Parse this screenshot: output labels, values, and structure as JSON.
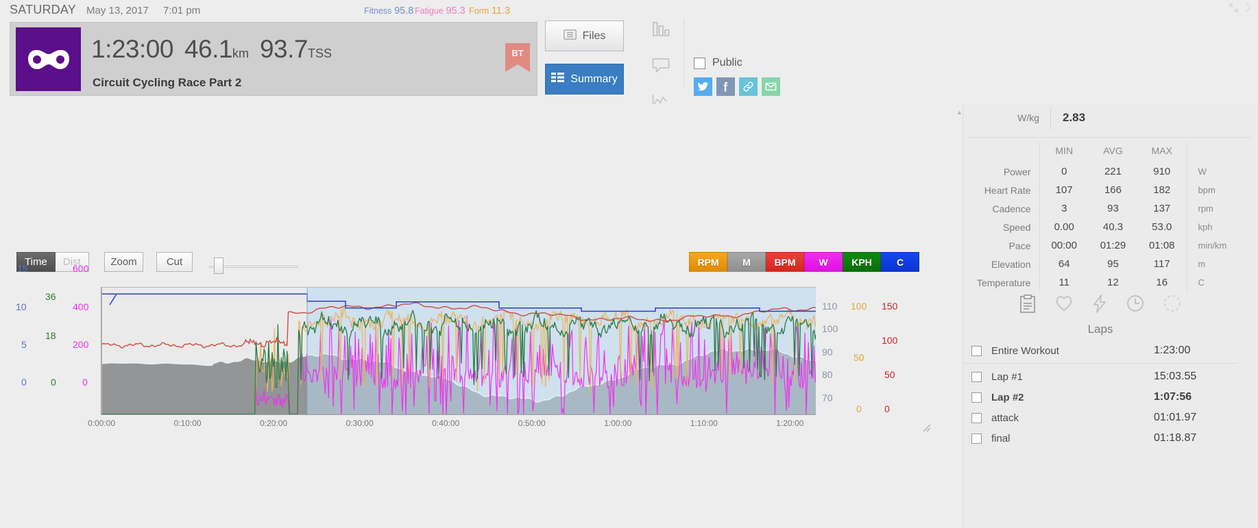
{
  "header": {
    "day": "SATURDAY",
    "date": "May 13, 2017",
    "time": "7:01 pm",
    "pmc": {
      "fitness_label": "Fitness",
      "fitness_value": "95.8",
      "fitness_color": "#6f92c9",
      "fatigue_label": "Fatigue",
      "fatigue_value": "95.3",
      "fatigue_color": "#ef7ec0",
      "form_label": "Form",
      "form_value": "11.3",
      "form_color": "#e8a33d"
    },
    "duration": "1:23:00",
    "distance": "46.1",
    "distance_unit": "km",
    "tss": "93.7",
    "tss_unit": "TSS",
    "workout_title": "Circuit Cycling Race Part 2",
    "badge": "BT",
    "files_button": "Files",
    "summary_button": "Summary",
    "public_label": "Public",
    "public_checked": false,
    "side_icons": [
      "bar-chart-icon",
      "comment-icon",
      "trend-icon"
    ],
    "social_icons": [
      {
        "name": "twitter-icon",
        "color": "#55acee"
      },
      {
        "name": "facebook-icon",
        "color": "#7f97b5"
      },
      {
        "name": "link-icon",
        "color": "#68c2d8"
      },
      {
        "name": "email-icon",
        "color": "#86d6aa"
      }
    ],
    "window_icons": [
      "expand-icon",
      "chevron-right-icon"
    ]
  },
  "chart_controls": {
    "time_label": "Time",
    "dist_label": "Dist",
    "zoom_label": "Zoom",
    "cut_label": "Cut",
    "active": "Time",
    "slider_value": 5
  },
  "legend": [
    {
      "label": "RPM",
      "color": "#f5a623",
      "gradient_to": "#e08c00"
    },
    {
      "label": "M",
      "color": "#a8a8a8",
      "gradient_to": "#8f8f8f"
    },
    {
      "label": "BPM",
      "color": "#e8433c",
      "gradient_to": "#d6241c"
    },
    {
      "label": "W",
      "color": "#ee2fee",
      "gradient_to": "#e010e0"
    },
    {
      "label": "KPH",
      "color": "#0f8a0f",
      "gradient_to": "#0a6f0a"
    },
    {
      "label": "C",
      "color": "#1548ee",
      "gradient_to": "#0b33d6"
    }
  ],
  "chart_data": {
    "type": "line",
    "title": "",
    "xlabel": "",
    "ylabel": "",
    "grid": false,
    "legend_position": "top-right",
    "x_ticks": [
      "0:00:00",
      "0:10:00",
      "0:20:00",
      "0:30:00",
      "0:40:00",
      "0:50:00",
      "1:00:00",
      "1:10:00",
      "1:20:00"
    ],
    "x_range_minutes": [
      0,
      83
    ],
    "selection_start_time": "0:14:30",
    "selection_end_time": "1:23:00",
    "axes": [
      {
        "id": "C",
        "side": "left",
        "label": "C",
        "color": "#5b6fd6",
        "ticks": [
          0,
          5,
          10,
          15
        ],
        "range": [
          0,
          17
        ]
      },
      {
        "id": "KPH",
        "side": "left",
        "label": "KPH",
        "color": "#2d7d2d",
        "ticks": [
          0,
          18,
          36
        ],
        "range": [
          0,
          53
        ]
      },
      {
        "id": "W",
        "side": "left",
        "label": "W",
        "color": "#ee2fee",
        "ticks": [
          0,
          200,
          400,
          600
        ],
        "range": [
          0,
          910
        ]
      },
      {
        "id": "M",
        "side": "right",
        "label": "M",
        "color": "#8795a6",
        "ticks": [
          70,
          80,
          90,
          100,
          110
        ],
        "range": [
          64,
          117
        ]
      },
      {
        "id": "RPM",
        "side": "right",
        "label": "RPM",
        "color": "#e8a33d",
        "ticks": [
          0,
          50,
          100
        ],
        "range": [
          0,
          137
        ]
      },
      {
        "id": "BPM",
        "side": "right",
        "label": "BPM",
        "color": "#cf2222",
        "ticks": [
          0,
          50,
          100,
          150
        ],
        "range": [
          0,
          182
        ]
      }
    ],
    "series": [
      {
        "name": "Elevation",
        "axis": "M",
        "color": "#98a7b5",
        "style": "area"
      },
      {
        "name": "Heart Rate",
        "axis": "BPM",
        "color": "#cf4a42",
        "style": "line"
      },
      {
        "name": "Cadence",
        "axis": "RPM",
        "color": "#e8b45c",
        "style": "line"
      },
      {
        "name": "Speed",
        "axis": "KPH",
        "color": "#2d7d4a",
        "style": "line"
      },
      {
        "name": "Power",
        "axis": "W",
        "color": "#ee2fee",
        "style": "line"
      },
      {
        "name": "Temperature",
        "axis": "C",
        "color": "#2a3fc9",
        "style": "step"
      }
    ]
  },
  "right_panel": {
    "wkg_label": "W/kg",
    "wkg_value": "2.83",
    "columns": [
      "MIN",
      "AVG",
      "MAX"
    ],
    "rows": [
      {
        "label": "Power",
        "min": "0",
        "avg": "221",
        "max": "910",
        "unit": "W"
      },
      {
        "label": "Heart Rate",
        "min": "107",
        "avg": "166",
        "max": "182",
        "unit": "bpm"
      },
      {
        "label": "Cadence",
        "min": "3",
        "avg": "93",
        "max": "137",
        "unit": "rpm"
      },
      {
        "label": "Speed",
        "min": "0.00",
        "avg": "40.3",
        "max": "53.0",
        "unit": "kph"
      },
      {
        "label": "Pace",
        "min": "00:00",
        "avg": "01:29",
        "max": "01:08",
        "unit": "min/km"
      },
      {
        "label": "Elevation",
        "min": "64",
        "avg": "95",
        "max": "117",
        "unit": "m"
      },
      {
        "label": "Temperature",
        "min": "11",
        "avg": "12",
        "max": "16",
        "unit": "C"
      }
    ],
    "tab_icons": [
      "clipboard-icon",
      "heart-icon",
      "lightning-icon",
      "clock-icon",
      "dashed-circle-icon"
    ],
    "selected_tab": "clipboard-icon",
    "laps_title": "Laps",
    "laps": [
      {
        "name": "Entire Workout",
        "time": "1:23:00",
        "bold": false,
        "checked": false
      },
      {
        "name": "Lap #1",
        "time": "15:03.55",
        "bold": false,
        "checked": false
      },
      {
        "name": "Lap #2",
        "time": "1:07:56",
        "bold": true,
        "checked": false
      },
      {
        "name": "attack",
        "time": "01:01.97",
        "bold": false,
        "checked": false
      },
      {
        "name": "final",
        "time": "01:18.87",
        "bold": false,
        "checked": false
      }
    ]
  }
}
